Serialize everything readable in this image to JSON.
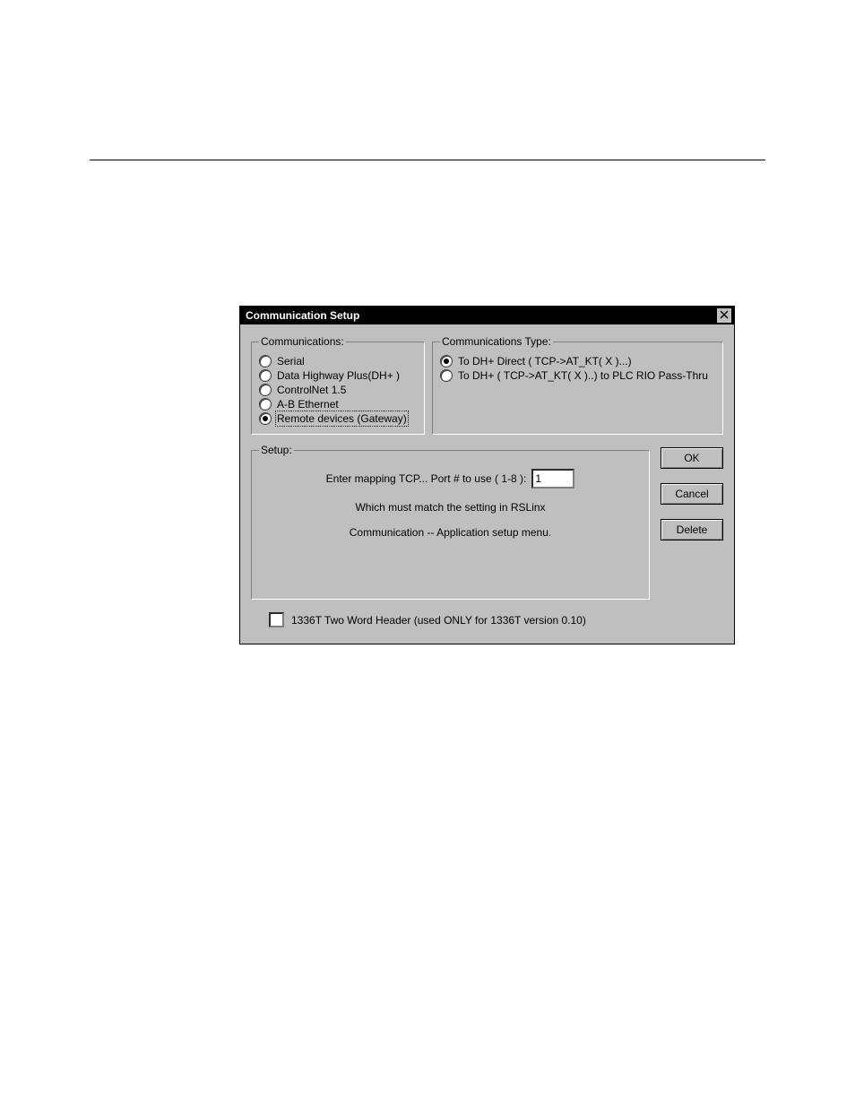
{
  "dialog": {
    "title": "Communication Setup",
    "close_icon": "close-icon"
  },
  "communications": {
    "legend": "Communications:",
    "options": [
      {
        "label": "Serial",
        "checked": false
      },
      {
        "label": "Data Highway Plus(DH+ )",
        "checked": false
      },
      {
        "label": "ControlNet 1.5",
        "checked": false
      },
      {
        "label": "A-B Ethernet",
        "checked": false
      },
      {
        "label": "Remote devices (Gateway)",
        "checked": true,
        "focused": true
      }
    ]
  },
  "communications_type": {
    "legend": "Communications Type:",
    "options": [
      {
        "label": "To DH+ Direct ( TCP->AT_KT( X )...)",
        "checked": true
      },
      {
        "label": "To DH+ ( TCP->AT_KT( X )..)  to PLC RIO Pass-Thru",
        "checked": false
      }
    ]
  },
  "setup": {
    "legend": "Setup:",
    "port_label": "Enter mapping TCP... Port  # to use ( 1-8 ):",
    "port_value": "1",
    "help1": "Which must match the setting in  RSLinx",
    "help2": "Communication -- Application setup menu."
  },
  "buttons": {
    "ok": "OK",
    "cancel": "Cancel",
    "delete": "Delete"
  },
  "footer": {
    "checkbox_label": "1336T Two Word Header (used ONLY for 1336T version 0.10)",
    "checked": false
  }
}
